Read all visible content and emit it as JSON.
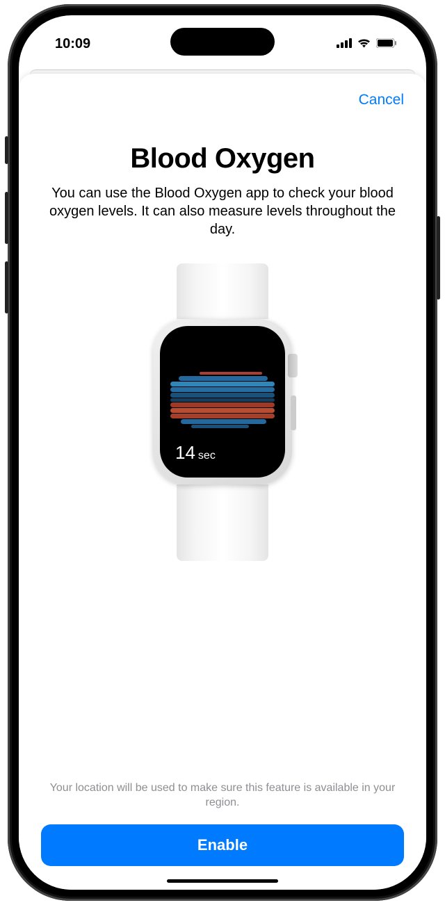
{
  "status": {
    "time": "10:09"
  },
  "nav": {
    "cancel": "Cancel"
  },
  "page": {
    "title": "Blood Oxygen",
    "description": "You can use the Blood Oxygen app to check your blood oxygen levels. It can also measure levels throughout the day."
  },
  "watch": {
    "timer_value": "14",
    "timer_unit": "sec"
  },
  "footer": {
    "disclaimer": "Your location will be used to make sure this feature is available in your region.",
    "enable": "Enable"
  }
}
